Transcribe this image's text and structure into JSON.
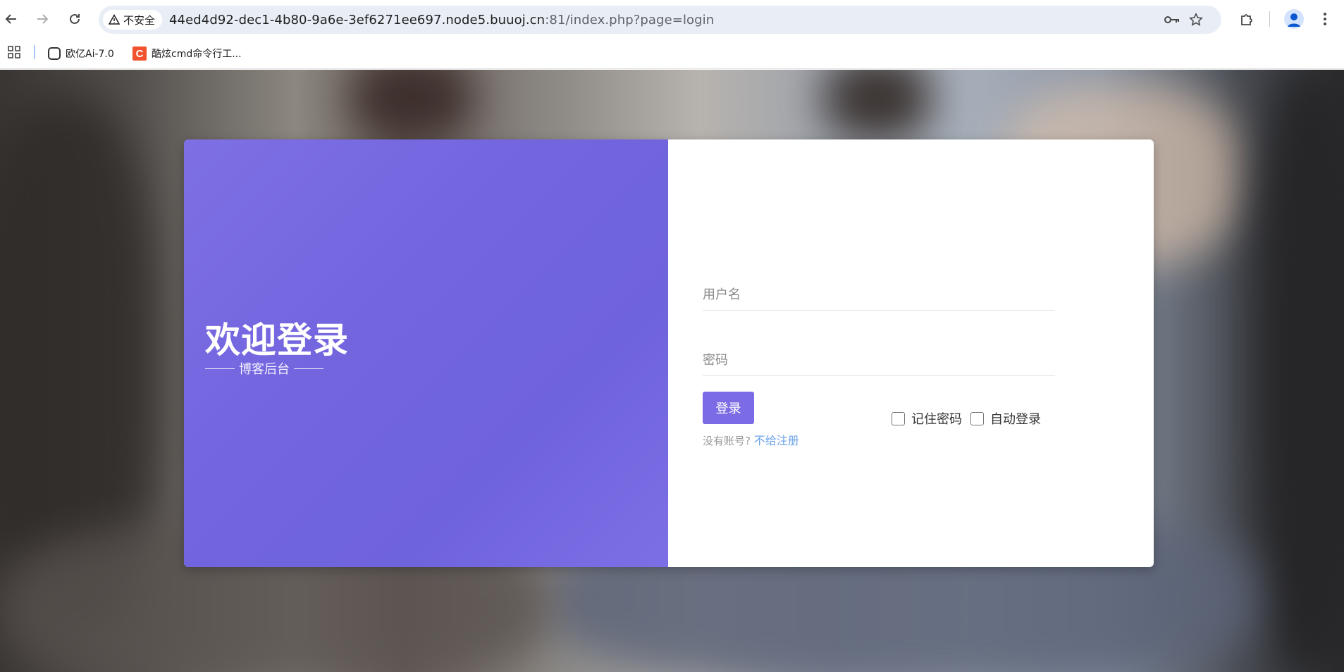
{
  "browser": {
    "security_label": "不安全",
    "url_main": "44ed4d92-dec1-4b80-9a6e-3ef6271ee697.node5.buuoj.cn",
    "url_rest": ":81/index.php?page=login",
    "icons": {
      "back": "back-arrow-icon",
      "forward": "forward-arrow-icon",
      "reload": "reload-icon",
      "password": "key-icon",
      "bookmark": "star-icon",
      "extensions": "puzzle-icon",
      "profile": "profile-icon",
      "menu": "kebab-menu-icon"
    }
  },
  "bookmarks": {
    "items": [
      {
        "label": "欧亿Ai-7.0"
      },
      {
        "label": "酷炫cmd命令行工..."
      }
    ],
    "fav2_letter": "C"
  },
  "login": {
    "welcome_title": "欢迎登录",
    "welcome_subtitle": "博客后台",
    "username_placeholder": "用户名",
    "password_placeholder": "密码",
    "login_button": "登录",
    "no_account_text": "没有账号?",
    "register_link": "不给注册",
    "remember_password": "记住密码",
    "auto_login": "自动登录"
  },
  "colors": {
    "accent": "#7b6be4",
    "link": "#6aa0e8"
  }
}
